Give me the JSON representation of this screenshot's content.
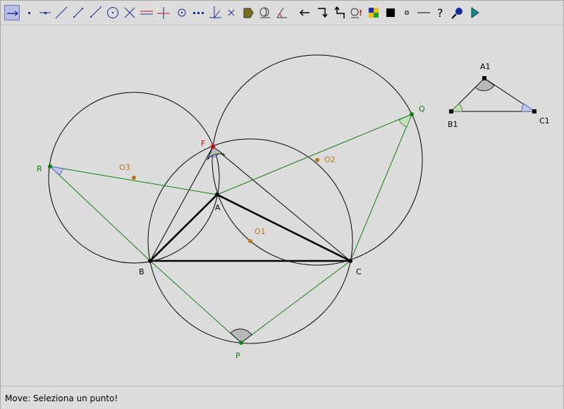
{
  "toolbar": {
    "tools": [
      {
        "name": "move-tool",
        "icon": "move-arrow-icon",
        "active": true
      },
      {
        "name": "point-tool",
        "icon": "point-icon"
      },
      {
        "name": "point-on-object-tool",
        "icon": "point-on-line-icon"
      },
      {
        "name": "line-tool",
        "icon": "line-icon"
      },
      {
        "name": "segment-tool",
        "icon": "segment-icon"
      },
      {
        "name": "ray-tool",
        "icon": "ray-icon"
      },
      {
        "name": "circle-tool",
        "icon": "circle-icon"
      },
      {
        "name": "intersection-tool",
        "icon": "intersection-icon"
      },
      {
        "name": "parallel-tool",
        "icon": "parallel-icon"
      },
      {
        "name": "perpendicular-tool",
        "icon": "perpendicular-icon"
      },
      {
        "name": "midpoint-tool",
        "icon": "midpoint-icon"
      },
      {
        "name": "locus-tool",
        "icon": "dotted-line-icon"
      },
      {
        "name": "angle-bisector-tool",
        "icon": "angle-bisector-icon"
      },
      {
        "name": "delete-tool",
        "icon": "delete-x-icon"
      },
      {
        "name": "polygon-tool",
        "icon": "polygon-icon"
      },
      {
        "name": "measure-tool",
        "icon": "measure-icon"
      },
      {
        "name": "angle-tool",
        "icon": "angle-icon"
      },
      {
        "name": "undo-tool",
        "icon": "left-arrow-icon"
      },
      {
        "name": "redo-tool",
        "icon": "redo-icon"
      },
      {
        "name": "reverse-tool",
        "icon": "reverse-icon"
      },
      {
        "name": "check-tool",
        "icon": "check-icon"
      },
      {
        "name": "color-tool",
        "icon": "color-palette-icon"
      },
      {
        "name": "fill-tool",
        "icon": "filled-square-icon"
      },
      {
        "name": "point-style-tool",
        "icon": "small-square-icon"
      },
      {
        "name": "line-style-tool",
        "icon": "dash-icon"
      },
      {
        "name": "help-tool",
        "icon": "help-icon"
      },
      {
        "name": "zoom-tool",
        "icon": "magnifier-icon"
      },
      {
        "name": "play-tool",
        "icon": "play-icon"
      }
    ]
  },
  "labels": {
    "A": "A",
    "B": "B",
    "C": "C",
    "F": "F",
    "P": "P",
    "Q": "Q",
    "R": "R",
    "O1": "O1",
    "O2": "O2",
    "O3": "O3",
    "A1": "A1",
    "B1": "B1",
    "C1": "C1"
  },
  "colors": {
    "line": "#000000",
    "green": "#128010",
    "orange": "#b87a1a",
    "red": "#c01010",
    "angle_fill": "#b8b8b8",
    "blue": "#3a4fd0"
  },
  "status": {
    "text": "Move: Seleziona un punto!"
  }
}
